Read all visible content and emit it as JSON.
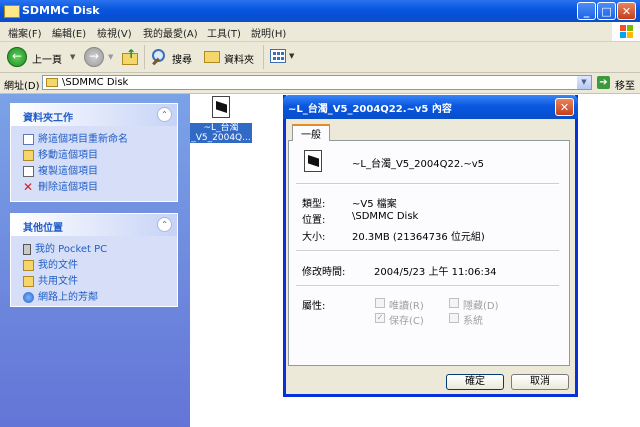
{
  "window": {
    "title": "SDMMC Disk"
  },
  "menu": [
    "檔案(F)",
    "編輯(E)",
    "檢視(V)",
    "我的最愛(A)",
    "工具(T)",
    "說明(H)"
  ],
  "toolbar": {
    "back_label": "上一頁",
    "search_label": "搜尋",
    "folders_label": "資料夾"
  },
  "address": {
    "label": "網址(D)",
    "value": "\\SDMMC Disk",
    "go_label": "移至"
  },
  "tasks_panel": {
    "title": "資料夾工作",
    "items": [
      "將這個項目重新命名",
      "移動這個項目",
      "複製這個項目",
      "刪除這個項目"
    ]
  },
  "places_panel": {
    "title": "其他位置",
    "items": [
      "我的 Pocket PC",
      "我的文件",
      "共用文件",
      "網路上的芳鄰"
    ]
  },
  "file": {
    "name_line1": "~L_台濁",
    "name_line2": "_V5_2004Q..."
  },
  "dialog": {
    "title": "~L_台濁_V5_2004Q22.~v5 內容",
    "tab": "一般",
    "file_name": "~L_台濁_V5_2004Q22.~v5",
    "type_label": "類型:",
    "type_value": "~V5 檔案",
    "location_label": "位置:",
    "location_value": "\\SDMMC Disk",
    "size_label": "大小:",
    "size_value": "20.3MB (21364736 位元組)",
    "modified_label": "修改時間:",
    "modified_value": "2004/5/23 上午 11:06:34",
    "attributes_label": "屬性:",
    "attributes": {
      "readonly": {
        "label": "唯讀(R)",
        "checked": false
      },
      "hidden": {
        "label": "隱藏(D)",
        "checked": false
      },
      "archive": {
        "label": "保存(C)",
        "checked": true
      },
      "system": {
        "label": "系統",
        "checked": false
      }
    },
    "ok_label": "確定",
    "cancel_label": "取消"
  }
}
